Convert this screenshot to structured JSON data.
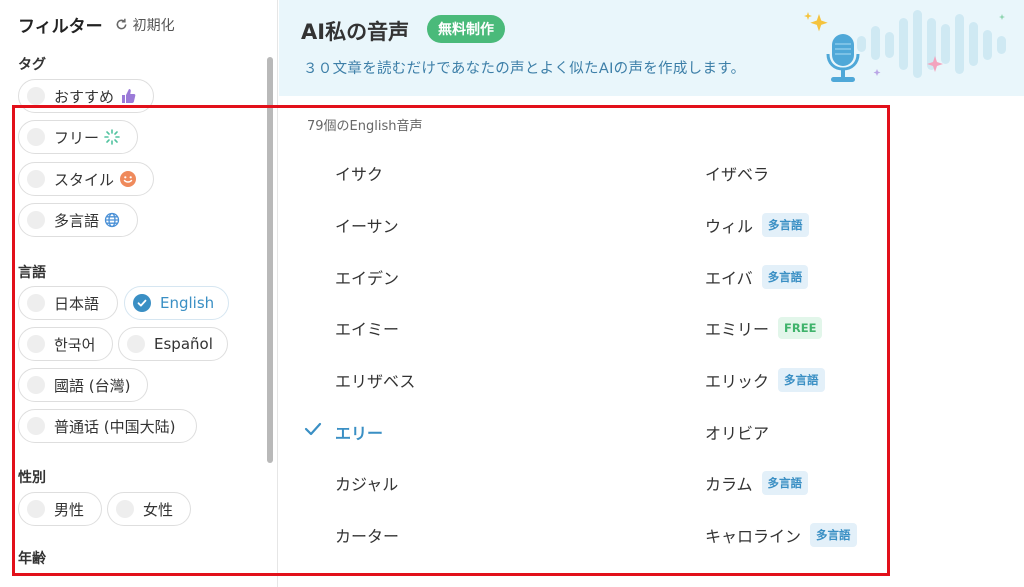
{
  "sidebar": {
    "title": "フィルター",
    "reset_label": "初期化",
    "sections": {
      "tag": "タグ",
      "language": "言語",
      "gender": "性別",
      "age": "年齢"
    },
    "tags": [
      "おすすめ",
      "フリー",
      "スタイル",
      "多言語"
    ],
    "languages": [
      "日本語",
      "English",
      "한국어",
      "Español",
      "國語 (台灣)",
      "普通话 (中国大陆)"
    ],
    "selected_language": "English",
    "genders": [
      "男性",
      "女性"
    ]
  },
  "banner": {
    "title": "AI私の音声",
    "badge": "無料制作",
    "subtitle": "３０文章を読むだけであなたの声とよく似たAIの声を作成します。"
  },
  "voices": {
    "count_label": "79個のEnglish音声",
    "left": [
      "イサク",
      "イーサン",
      "エイデン",
      "エイミー",
      "エリザベス",
      "エリー",
      "カジャル",
      "カーター"
    ],
    "right": [
      "イザベラ",
      "ウィル",
      "エイバ",
      "エミリー",
      "エリック",
      "オリビア",
      "カラム",
      "キャロライン"
    ],
    "selected": "エリー",
    "tags": {
      "multilingual": "多言語",
      "free": "FREE"
    }
  },
  "colors": {
    "accent": "#3a8fc4",
    "badge_green": "#4aba7a",
    "banner_bg": "#e9f6fb",
    "highlight_frame": "#e2101a"
  }
}
